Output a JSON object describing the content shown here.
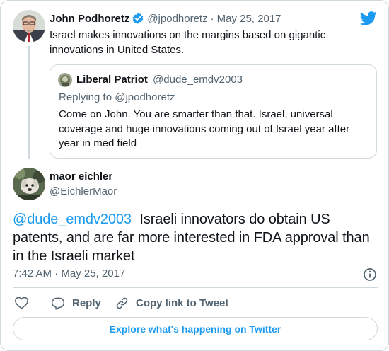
{
  "parent_tweet": {
    "author_name": "John Podhoretz",
    "handle": "@jpodhoretz",
    "separator": "·",
    "date": "May 25, 2017",
    "text_line1": "Israel makes innovations on the margins based on gigantic",
    "text_line2": "innovations in United States."
  },
  "quoted_tweet": {
    "author_name": "Liberal Patriot",
    "handle": "@dude_emdv2003",
    "replying_to": "Replying to @jpodhoretz",
    "text_line1": "Come on John. You are smarter than that. Israel, universal",
    "text_line2": "coverage and huge innovations coming out of Israel year after",
    "text_line3": "year in med field"
  },
  "main_tweet": {
    "author_name": "maor eichler",
    "handle": "@EichlerMaor",
    "mention": "@dude_emdv2003",
    "text_line1_rest": "Israeli innovators do obtain US",
    "text_line2": "patents, and are far more interested in FDA approval than",
    "text_line3": "in the Israeli market",
    "timestamp": "7:42 AM · May 25, 2017"
  },
  "actions": {
    "reply_label": "Reply",
    "copy_link_label": "Copy link to Tweet"
  },
  "explore_button_label": "Explore what's happening on Twitter",
  "colors": {
    "accent": "#1d9bf0",
    "text": "#0f1419",
    "muted": "#536471",
    "border": "#cfd9de"
  },
  "icons": [
    "twitter-logo-icon",
    "verified-badge-icon",
    "info-icon",
    "heart-icon",
    "reply-icon",
    "link-icon"
  ]
}
